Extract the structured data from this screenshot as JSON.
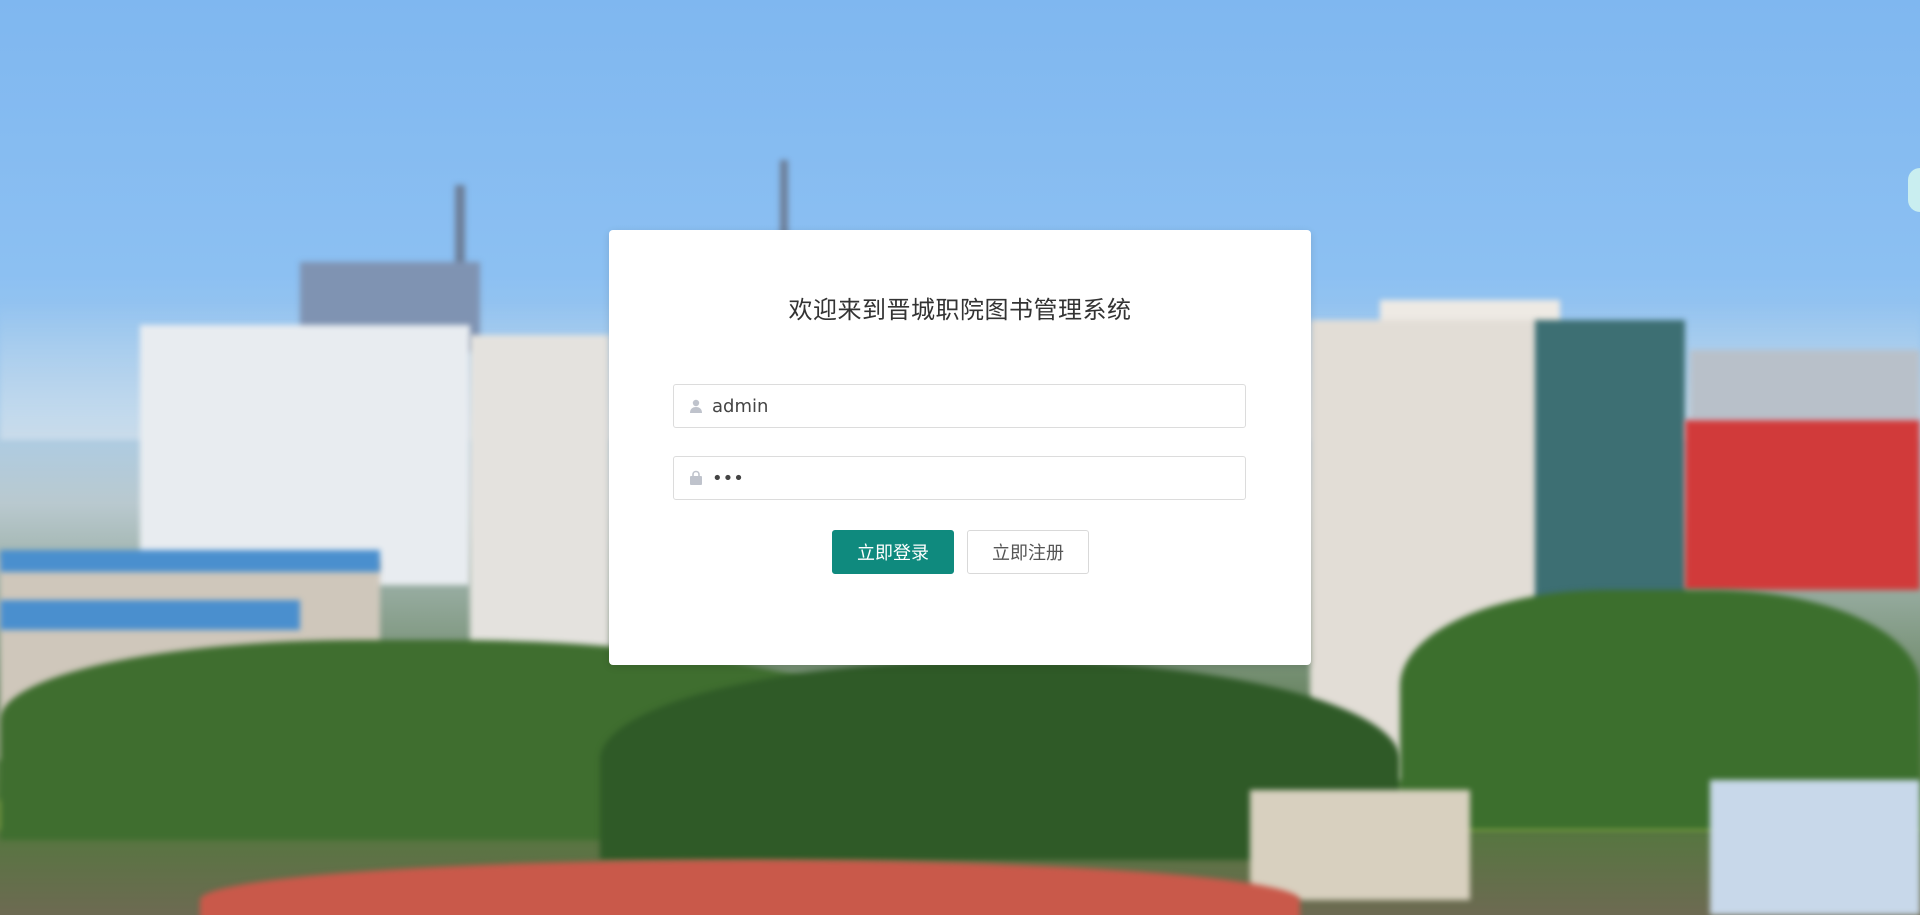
{
  "login": {
    "title": "欢迎来到晋城职院图书管理系统",
    "username": {
      "value": "admin",
      "icon": "user-icon"
    },
    "password": {
      "value": "•••",
      "icon": "lock-icon"
    },
    "login_button": "立即登录",
    "register_button": "立即注册"
  },
  "colors": {
    "primary": "#0f8a7e",
    "card_bg": "#ffffff"
  }
}
